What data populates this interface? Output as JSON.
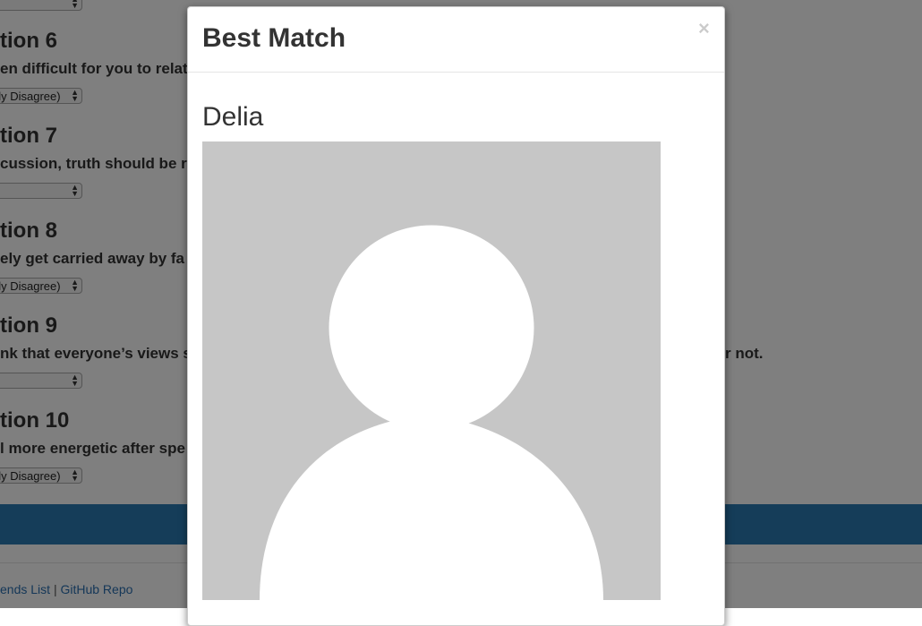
{
  "questions": [
    {
      "title": "tion 6",
      "text": "en difficult for you to relat",
      "select": "gly Disagree)"
    },
    {
      "title": "tion 7",
      "text": "cussion, truth should be r",
      "select": ""
    },
    {
      "title": "tion 8",
      "text": "ely get carried away by fa",
      "select": "gly Disagree)"
    },
    {
      "title": "tion 9",
      "text": "nk that everyone’s views s",
      "text_tail": "r not.",
      "select": ""
    },
    {
      "title": "tion 10",
      "text": "l more energetic after spe",
      "select": "gly Disagree)"
    }
  ],
  "top_select": "",
  "footer": {
    "link1": "ends List",
    "separator": "|",
    "link2": "GitHub Repo"
  },
  "modal": {
    "title": "Best Match",
    "close": "×",
    "match_name": "Delia",
    "avatar_icon": "person-placeholder-icon"
  },
  "colors": {
    "band": "#2a7bb3",
    "link": "#2a6fb0",
    "avatar_bg": "#c6c6c6"
  }
}
